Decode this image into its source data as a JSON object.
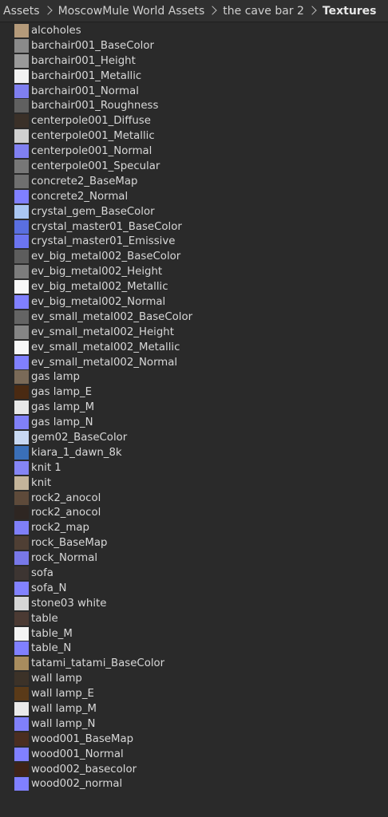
{
  "breadcrumb": [
    {
      "label": "Assets"
    },
    {
      "label": "MoscowMule World Assets"
    },
    {
      "label": "the cave bar 2"
    },
    {
      "label": "Textures"
    }
  ],
  "items": [
    {
      "label": "alcoholes",
      "thumb": "#b49a7a"
    },
    {
      "label": "barchair001_BaseColor",
      "thumb": "#8a8a8a"
    },
    {
      "label": "barchair001_Height",
      "thumb": "#9a9a9a"
    },
    {
      "label": "barchair001_Metallic",
      "thumb": "#f2f2f2"
    },
    {
      "label": "barchair001_Normal",
      "thumb": "#7f7ff0"
    },
    {
      "label": "barchair001_Roughness",
      "thumb": "#606060"
    },
    {
      "label": "centerpole001_Diffuse",
      "thumb": "#3a3028"
    },
    {
      "label": "centerpole001_Metallic",
      "thumb": "#d0d0d0"
    },
    {
      "label": "centerpole001_Normal",
      "thumb": "#8080f2"
    },
    {
      "label": "centerpole001_Specular",
      "thumb": "#777777"
    },
    {
      "label": "concrete2_BaseMap",
      "thumb": "#6f6f6f"
    },
    {
      "label": "concrete2_Normal",
      "thumb": "#8080ff"
    },
    {
      "label": "crystal_gem_BaseColor",
      "thumb": "#a9c6f3"
    },
    {
      "label": "crystal_master01_BaseColor",
      "thumb": "#5a6fe0"
    },
    {
      "label": "crystal_master01_Emissive",
      "thumb": "#6b74f0"
    },
    {
      "label": "ev_big_metal002_BaseColor",
      "thumb": "#5d5d5d"
    },
    {
      "label": "ev_big_metal002_Height",
      "thumb": "#7c7c7c"
    },
    {
      "label": "ev_big_metal002_Metallic",
      "thumb": "#f8f8f8"
    },
    {
      "label": "ev_big_metal002_Normal",
      "thumb": "#8080ff"
    },
    {
      "label": "ev_small_metal002_BaseColor",
      "thumb": "#646464"
    },
    {
      "label": "ev_small_metal002_Height",
      "thumb": "#858585"
    },
    {
      "label": "ev_small_metal002_Metallic",
      "thumb": "#f8f8f8"
    },
    {
      "label": "ev_small_metal002_Normal",
      "thumb": "#8080ff"
    },
    {
      "label": "gas lamp",
      "thumb": "#7a6a58"
    },
    {
      "label": "gas lamp_E",
      "thumb": "#4a2a12"
    },
    {
      "label": "gas lamp_M",
      "thumb": "#e8e8e8"
    },
    {
      "label": "gas lamp_N",
      "thumb": "#8080f8"
    },
    {
      "label": "gem02_BaseColor",
      "thumb": "#c8d8f2"
    },
    {
      "label": "kiara_1_dawn_8k",
      "thumb": "#3a6fb8"
    },
    {
      "label": "knit 1",
      "thumb": "#8585f5"
    },
    {
      "label": "knit",
      "thumb": "#c4b49a"
    },
    {
      "label": "rock2_anocol",
      "thumb": "#5e4a3a"
    },
    {
      "label": "rock2_anocol",
      "thumb": "#2e2622"
    },
    {
      "label": "rock2_map",
      "thumb": "#7f7ff8"
    },
    {
      "label": "rock_BaseMap",
      "thumb": "#4f3f34"
    },
    {
      "label": "rock_Normal",
      "thumb": "#7878e8"
    },
    {
      "label": "sofa",
      "thumb": "#3d3532"
    },
    {
      "label": "sofa_N",
      "thumb": "#8282ff"
    },
    {
      "label": "stone03 white",
      "thumb": "#d6d6d6"
    },
    {
      "label": "table",
      "thumb": "#4b3a33"
    },
    {
      "label": "table_M",
      "thumb": "#f4f4f4"
    },
    {
      "label": "table_N",
      "thumb": "#8080ff"
    },
    {
      "label": "tatami_tatami_BaseColor",
      "thumb": "#a88c5e"
    },
    {
      "label": "wall lamp",
      "thumb": "#3c3228"
    },
    {
      "label": "wall lamp_E",
      "thumb": "#5a3a18"
    },
    {
      "label": "wall lamp_M",
      "thumb": "#eaeaea"
    },
    {
      "label": "wall lamp_N",
      "thumb": "#8080fa"
    },
    {
      "label": "wood001_BaseMap",
      "thumb": "#4a2e20"
    },
    {
      "label": "wood001_Normal",
      "thumb": "#8080ff"
    },
    {
      "label": "wood002_basecolor",
      "thumb": "#3e2418"
    },
    {
      "label": "wood002_normal",
      "thumb": "#8080ff"
    }
  ]
}
